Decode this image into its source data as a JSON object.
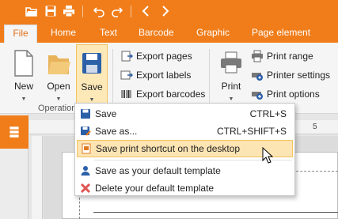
{
  "quick_access": {
    "icons": [
      "open-folder-icon",
      "save-icon",
      "print-icon",
      "undo-icon",
      "redo-icon",
      "back-icon",
      "forward-icon"
    ]
  },
  "tabs": {
    "file": "File",
    "home": "Home",
    "text": "Text",
    "barcode": "Barcode",
    "graphic": "Graphic",
    "page_element": "Page element"
  },
  "ribbon": {
    "new_label": "New",
    "open_label": "Open",
    "save_label": "Save",
    "operations_group": "Operation",
    "export_pages": "Export pages",
    "export_labels": "Export labels",
    "export_barcodes": "Export barcodes",
    "print_label": "Print",
    "print_range": "Print range",
    "printer_settings": "Printer settings",
    "print_options": "Print options"
  },
  "ruler": {
    "h_number": "5"
  },
  "menu": {
    "items": [
      {
        "label": "Save",
        "shortcut": "CTRL+S"
      },
      {
        "label": "Save as...",
        "shortcut": "CTRL+SHIFT+S"
      },
      {
        "label": "Save print shortcut on the desktop",
        "shortcut": ""
      },
      {
        "label": "Save as your default template",
        "shortcut": ""
      },
      {
        "label": "Delete your default template",
        "shortcut": ""
      }
    ]
  },
  "colors": {
    "accent": "#f07d1a",
    "hover": "#fde4b3",
    "save_blue": "#2b5fa8",
    "delete_red": "#e05555"
  }
}
